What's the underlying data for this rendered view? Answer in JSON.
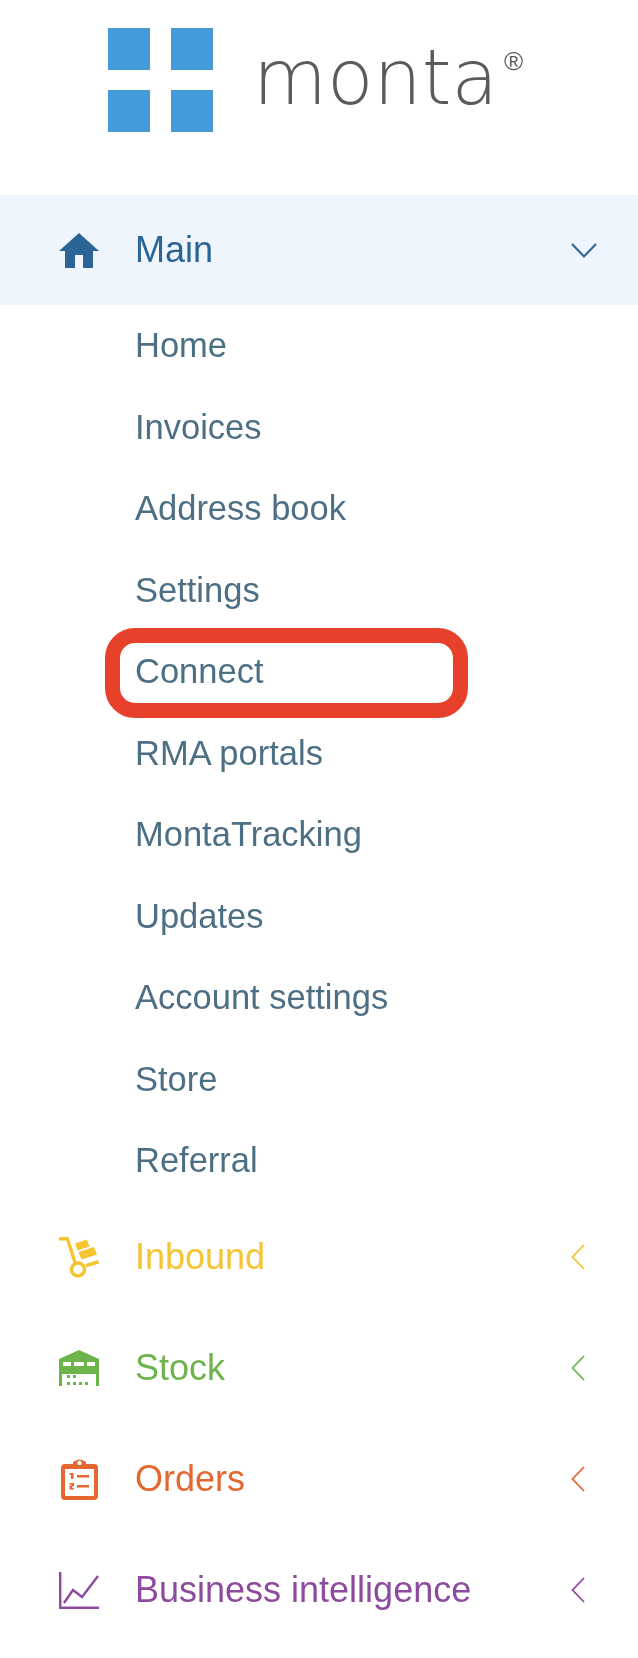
{
  "logo": {
    "wordmark": "monta",
    "registered_mark": "®"
  },
  "nav": [
    {
      "label": "Main",
      "color": "#2a6596",
      "expanded": true,
      "items": [
        {
          "label": "Home",
          "highlighted": false
        },
        {
          "label": "Invoices",
          "highlighted": false
        },
        {
          "label": "Address book",
          "highlighted": false
        },
        {
          "label": "Settings",
          "highlighted": false
        },
        {
          "label": "Connect",
          "highlighted": true
        },
        {
          "label": "RMA portals",
          "highlighted": false
        },
        {
          "label": "MontaTracking",
          "highlighted": false
        },
        {
          "label": "Updates",
          "highlighted": false
        },
        {
          "label": "Account settings",
          "highlighted": false
        },
        {
          "label": "Store",
          "highlighted": false
        },
        {
          "label": "Referral",
          "highlighted": false
        }
      ]
    },
    {
      "label": "Inbound",
      "color": "#f5c431",
      "expanded": false
    },
    {
      "label": "Stock",
      "color": "#6db44c",
      "expanded": false
    },
    {
      "label": "Orders",
      "color": "#e4672f",
      "expanded": false
    },
    {
      "label": "Business intelligence",
      "color": "#8e4a9e",
      "expanded": false
    }
  ]
}
